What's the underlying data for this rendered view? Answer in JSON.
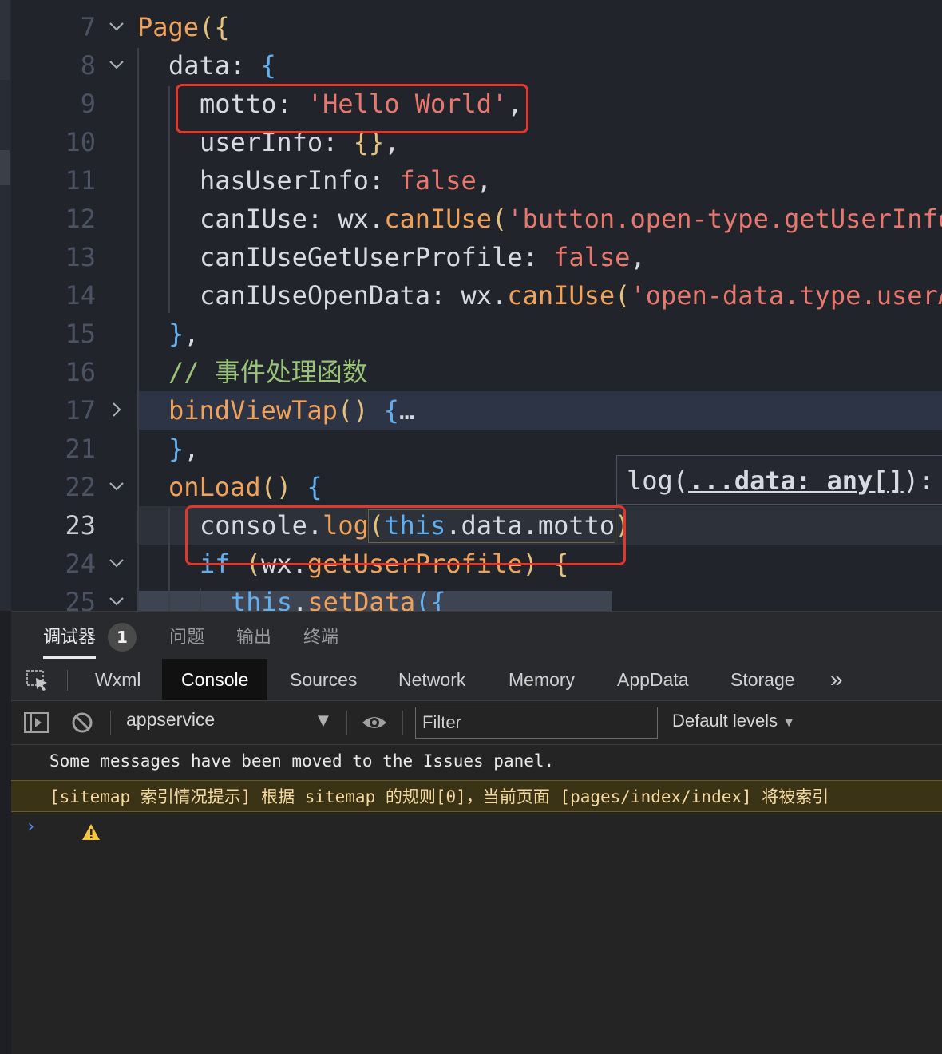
{
  "editor": {
    "lines": [
      {
        "num": "7",
        "fold": "down",
        "indent": 172,
        "tokens": [
          [
            "t-call",
            "Page"
          ],
          [
            "t-brace2",
            "({"
          ]
        ]
      },
      {
        "num": "8",
        "fold": "down",
        "indent": 211,
        "tokens": [
          [
            "t-punc",
            "data: "
          ],
          [
            "t-brace",
            "{"
          ]
        ]
      },
      {
        "num": "9",
        "fold": "",
        "indent": 250,
        "tokens": [
          [
            "t-punc",
            "motto: "
          ],
          [
            "t-str",
            "'Hello World'"
          ],
          [
            "t-punc",
            ","
          ]
        ]
      },
      {
        "num": "10",
        "fold": "",
        "indent": 250,
        "tokens": [
          [
            "t-punc",
            "userInfo: "
          ],
          [
            "t-brace2",
            "{}"
          ],
          [
            "t-punc",
            ","
          ]
        ]
      },
      {
        "num": "11",
        "fold": "",
        "indent": 250,
        "tokens": [
          [
            "t-punc",
            "hasUserInfo: "
          ],
          [
            "t-bool",
            "false"
          ],
          [
            "t-punc",
            ","
          ]
        ]
      },
      {
        "num": "12",
        "fold": "",
        "indent": 250,
        "tokens": [
          [
            "t-punc",
            "canIUse: wx."
          ],
          [
            "t-call",
            "canIUse"
          ],
          [
            "t-brace2",
            "("
          ],
          [
            "t-str",
            "'button.open-type.getUserInfo')"
          ]
        ]
      },
      {
        "num": "13",
        "fold": "",
        "indent": 250,
        "tokens": [
          [
            "t-punc",
            "canIUseGetUserProfile: "
          ],
          [
            "t-bool",
            "false"
          ],
          [
            "t-punc",
            ","
          ]
        ]
      },
      {
        "num": "14",
        "fold": "",
        "indent": 250,
        "tokens": [
          [
            "t-punc",
            "canIUseOpenData: wx."
          ],
          [
            "t-call",
            "canIUse"
          ],
          [
            "t-brace2",
            "("
          ],
          [
            "t-str",
            "'open-data.type.userAvatarUrl')"
          ]
        ]
      },
      {
        "num": "15",
        "fold": "",
        "indent": 211,
        "tokens": [
          [
            "t-brace",
            "}"
          ],
          [
            "t-punc",
            ","
          ]
        ]
      },
      {
        "num": "16",
        "fold": "",
        "indent": 211,
        "tokens": [
          [
            "t-cmt",
            "// 事件处理函数"
          ]
        ]
      },
      {
        "num": "17",
        "fold": "right",
        "indent": 211,
        "tokens": [
          [
            "t-call",
            "bindViewTap"
          ],
          [
            "t-brace2",
            "()"
          ],
          [
            "t-punc",
            " "
          ],
          [
            "t-brace",
            "{"
          ],
          [
            "t-punc",
            "…"
          ]
        ]
      },
      {
        "num": "21",
        "fold": "",
        "indent": 211,
        "tokens": [
          [
            "t-brace",
            "}"
          ],
          [
            "t-punc",
            ","
          ]
        ]
      },
      {
        "num": "22",
        "fold": "down",
        "indent": 211,
        "tokens": [
          [
            "t-call",
            "onLoad"
          ],
          [
            "t-brace2",
            "()"
          ],
          [
            "t-punc",
            " "
          ],
          [
            "t-brace",
            "{"
          ]
        ]
      },
      {
        "num": "23",
        "fold": "",
        "indent": 250,
        "active": true,
        "tokens": [
          [
            "t-punc",
            "console."
          ],
          [
            "t-call",
            "log"
          ],
          [
            "t-brace2",
            "("
          ],
          [
            "t-kw",
            "this"
          ],
          [
            "t-punc",
            ".data.motto"
          ],
          [
            "t-brace2",
            ")"
          ]
        ]
      },
      {
        "num": "24",
        "fold": "down",
        "indent": 250,
        "tokens": [
          [
            "t-kw",
            "if"
          ],
          [
            "t-punc",
            " "
          ],
          [
            "t-brace2",
            "("
          ],
          [
            "t-punc",
            "wx."
          ],
          [
            "t-call",
            "getUserProfile"
          ],
          [
            "t-brace2",
            ")"
          ],
          [
            "t-punc",
            " "
          ],
          [
            "t-brace2",
            "{"
          ]
        ]
      },
      {
        "num": "25",
        "fold": "down",
        "indent": 289,
        "tokens": [
          [
            "t-kw",
            "this"
          ],
          [
            "t-punc",
            "."
          ],
          [
            "t-call",
            "setData"
          ],
          [
            "t-brace",
            "({"
          ]
        ]
      }
    ],
    "tooltip": {
      "prefix": "log(",
      "param": "...data: any[]",
      "suffix": "):"
    }
  },
  "panel": {
    "tabs": [
      {
        "label": "调试器",
        "active": true
      },
      {
        "label": "问题",
        "active": false
      },
      {
        "label": "输出",
        "active": false
      },
      {
        "label": "终端",
        "active": false
      }
    ],
    "badge": "1",
    "devtools_tabs": [
      "Wxml",
      "Console",
      "Sources",
      "Network",
      "Memory",
      "AppData",
      "Storage"
    ],
    "devtools_active": "Console",
    "more_label": "»",
    "context": "appservice",
    "filter_placeholder": "Filter",
    "levels": "Default levels",
    "messages": {
      "info": "Some messages have been moved to the Issues panel.",
      "warn": "[sitemap 索引情况提示] 根据 sitemap 的规则[0]，当前页面 [pages/index/index] 将被索引"
    },
    "prompt": "›"
  },
  "colors": {
    "highlight_box": "#e5362a",
    "accent": "#4c8bf5",
    "warning_bg": "#3a3316"
  }
}
